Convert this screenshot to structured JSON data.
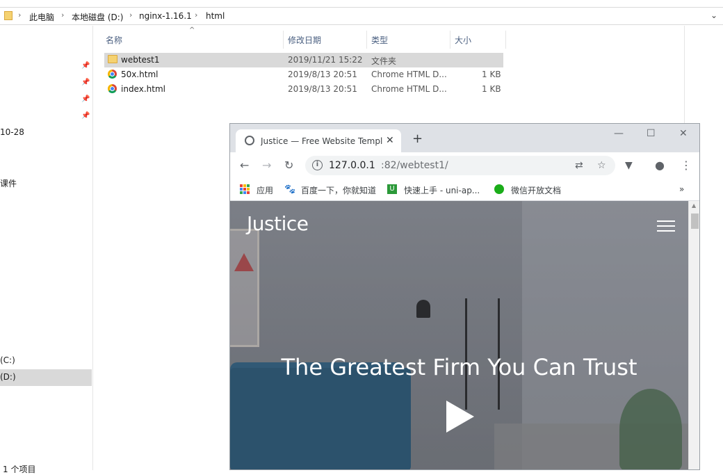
{
  "explorer": {
    "breadcrumb": [
      "此电脑",
      "本地磁盘 (D:)",
      "nginx-1.16.1",
      "html"
    ],
    "nav_items": {
      "date_fragment": "10-28",
      "item_fragment": "课件",
      "drive_c": "(C:)",
      "drive_d": "(D:)"
    },
    "columns": {
      "name": "名称",
      "date": "修改日期",
      "type": "类型",
      "size": "大小"
    },
    "files": [
      {
        "name": "webtest1",
        "date": "2019/11/21 15:22",
        "type": "文件夹",
        "size": "",
        "icon": "folder-icon"
      },
      {
        "name": "50x.html",
        "date": "2019/8/13 20:51",
        "type": "Chrome HTML D...",
        "size": "1 KB",
        "icon": "chrome-icon"
      },
      {
        "name": "index.html",
        "date": "2019/8/13 20:51",
        "type": "Chrome HTML D...",
        "size": "1 KB",
        "icon": "chrome-icon"
      }
    ],
    "status": "1 个项目"
  },
  "browser": {
    "tab_title": "Justice — Free Website Template",
    "url_host": "127.0.0.1",
    "url_path": ":82/webtest1/",
    "bookmarks": [
      {
        "label": "应用",
        "icon": "apps-icon"
      },
      {
        "label": "百度一下，你就知道",
        "icon": "baidu-paw-icon"
      },
      {
        "label": "快速上手 - uni-ap...",
        "icon": "uni-app-icon"
      },
      {
        "label": "微信开放文档",
        "icon": "wechat-icon"
      }
    ],
    "more_bookmarks": "»"
  },
  "page": {
    "brand": "Justice",
    "headline": "The Greatest Firm You Can Trust"
  },
  "colors": {
    "selection": "#d9d9d9",
    "chrome_frame": "#dee1e6",
    "omnibox": "#f1f3f4",
    "hero_overlay": "#3c414b"
  }
}
